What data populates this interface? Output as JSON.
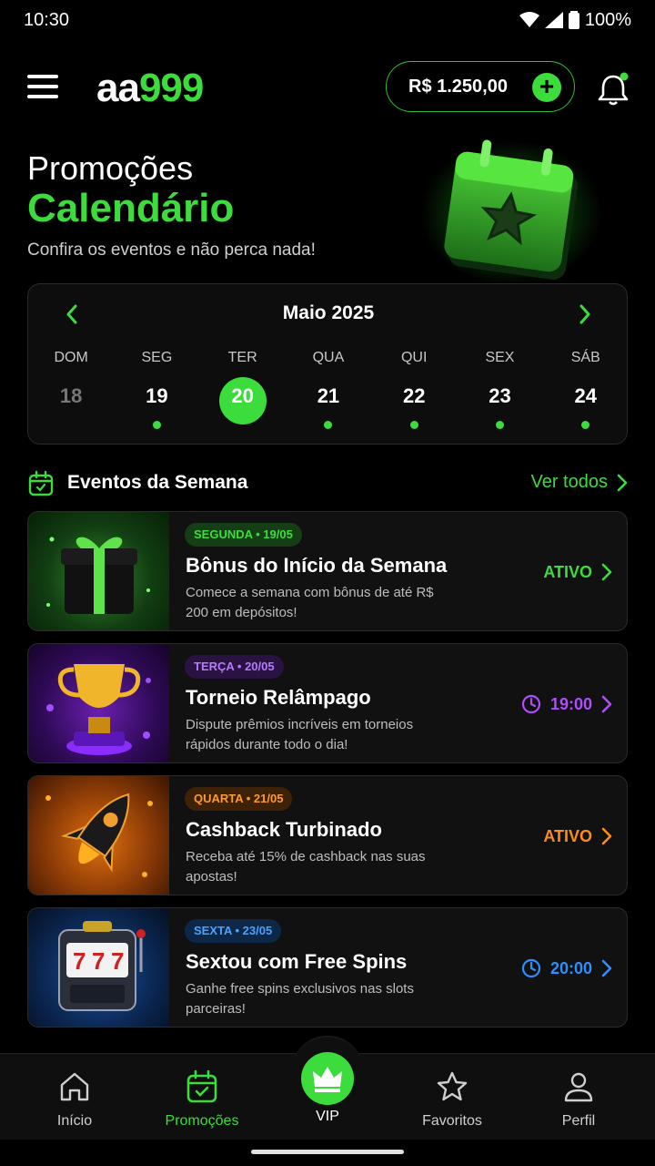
{
  "status": {
    "time": "10:30",
    "battery": "100%"
  },
  "header": {
    "logo_aa": "aa",
    "logo_num": "999",
    "balance": "R$ 1.250,00",
    "add_label": "+"
  },
  "hero": {
    "title1": "Promoções",
    "title2": "Calendário",
    "subtitle": "Confira os eventos e não perca nada!"
  },
  "calendar": {
    "month": "Maio 2025",
    "days": [
      {
        "dow": "DOM",
        "num": "18"
      },
      {
        "dow": "SEG",
        "num": "19"
      },
      {
        "dow": "TER",
        "num": "20"
      },
      {
        "dow": "QUA",
        "num": "21"
      },
      {
        "dow": "QUI",
        "num": "22"
      },
      {
        "dow": "SEX",
        "num": "23"
      },
      {
        "dow": "SÁB",
        "num": "24"
      }
    ]
  },
  "events_section": {
    "title": "Eventos da Semana",
    "see_all": "Ver todos"
  },
  "events": [
    {
      "tag": "SEGUNDA • 19/05",
      "title": "Bônus do Início da Semana",
      "desc": "Comece a semana com bônus de até R$ 200 em depósitos!",
      "status": "ATIVO",
      "color": "#3ddc3d"
    },
    {
      "tag": "TERÇA • 20/05",
      "title": "Torneio Relâmpago",
      "desc": "Dispute prêmios incríveis em torneios rápidos durante todo o dia!",
      "status": "19:00",
      "color": "#b04dff"
    },
    {
      "tag": "QUARTA • 21/05",
      "title": "Cashback Turbinado",
      "desc": "Receba até 15% de cashback nas suas apostas!",
      "status": "ATIVO",
      "color": "#ff8c1a"
    },
    {
      "tag": "SEXTA • 23/05",
      "title": "Sextou com Free Spins",
      "desc": "Ganhe free spins exclusivos nas slots parceiras!",
      "status": "20:00",
      "color": "#2f8fff"
    }
  ],
  "nav": {
    "home": "Início",
    "promos": "Promoções",
    "vip": "VIP",
    "favorites": "Favoritos",
    "profile": "Perfil"
  },
  "colors": {
    "accent": "#3ddc3d",
    "background": "#000000"
  }
}
